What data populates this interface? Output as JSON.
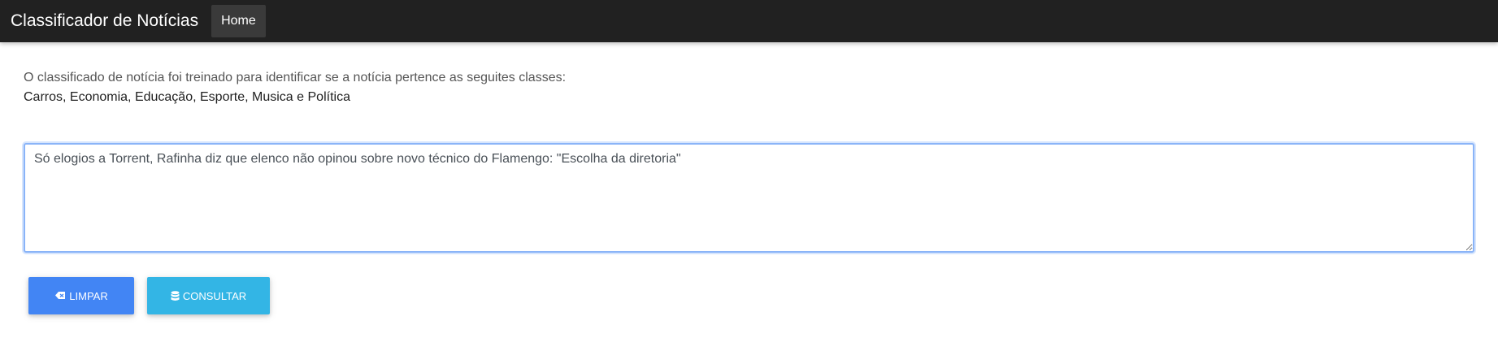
{
  "navbar": {
    "brand": "Classificador de Notícias",
    "links": [
      {
        "label": "Home"
      }
    ]
  },
  "main": {
    "description": "O classificado de notícia foi treinado para identificar se a notícia pertence as seguites classes:",
    "classes": "Carros, Economia, Educação, Esporte, Musica e Política",
    "news_input": {
      "value": "Só elogios a Torrent, Rafinha diz que elenco não opinou sobre novo técnico do Flamengo: \"Escolha da diretoria\""
    },
    "buttons": {
      "clear_label": "LIMPAR",
      "clear_icon": "eraser-icon",
      "query_label": "CONSULTAR",
      "query_icon": "database-icon"
    }
  },
  "colors": {
    "navbar_bg": "#212121",
    "clear_button": "#4285f4",
    "query_button": "#33b5e5",
    "input_focus_border": "#8ab4f8"
  }
}
